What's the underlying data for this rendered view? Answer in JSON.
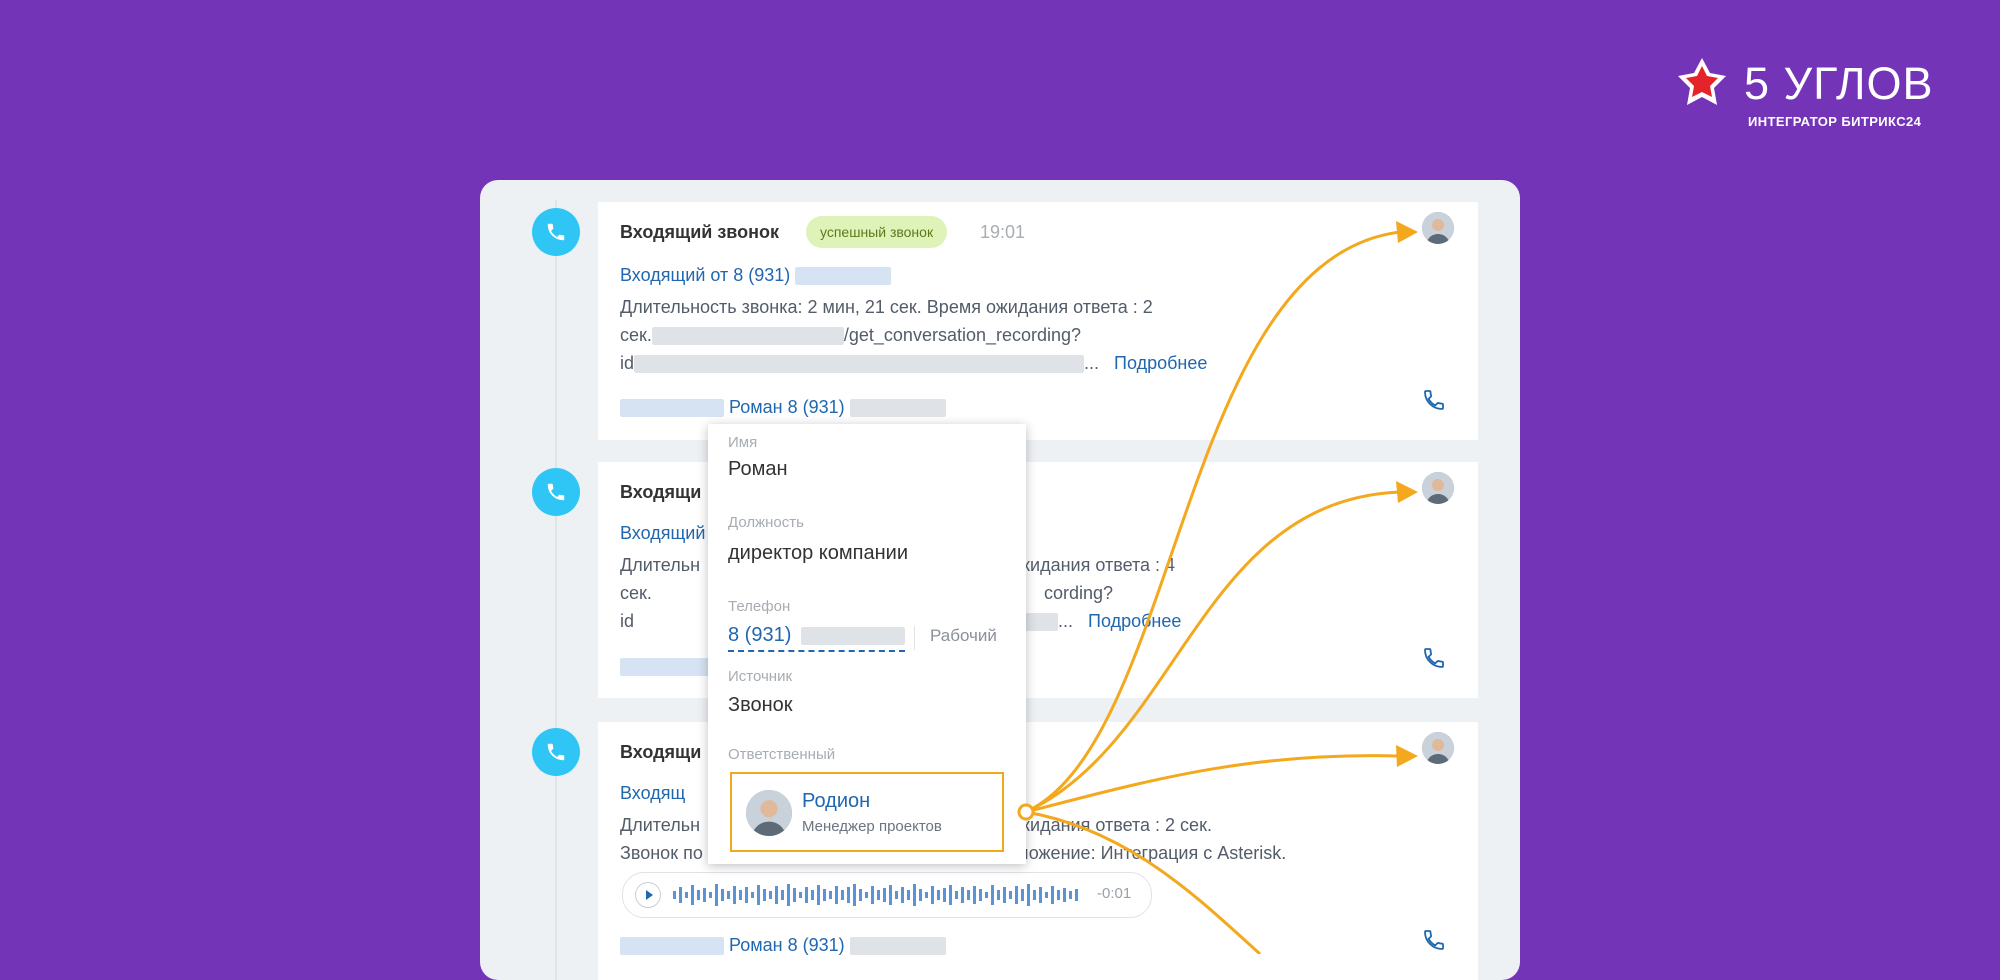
{
  "logo": {
    "title": "5 УГЛОВ",
    "subtitle": "ИНТЕГРАТОР БИТРИКС24"
  },
  "cards": [
    {
      "title": "Входящий звонок",
      "badge": "успешный звонок",
      "time": "19:01",
      "incoming": "Входящий от 8 (931)",
      "duration": "Длительность звонка: 2 мин, 21 сек. Время ожидания ответа : 2",
      "url_prefix": "сек.",
      "url_path": "/get_conversation_recording?",
      "id_prefix": "id",
      "ellipsis": "...",
      "more": "Подробнее",
      "contact": "Роман 8 (931)"
    },
    {
      "title": "Входящи",
      "incoming": "Входящий",
      "duration_start": "Длительн",
      "duration_end": "жидания ответа : 4",
      "url_prefix": "сек.",
      "url_path": "cording?",
      "id_prefix": "id",
      "ellipsis": "...",
      "more": "Подробнее"
    },
    {
      "title": "Входящи",
      "incoming": "Входящ",
      "duration_start": "Длительн",
      "duration_end": "жидания ответа : 2 сек.",
      "note_start": "Звонок по",
      "note_end": "ложение: Интеграция с Asterisk.",
      "player_time": "-0:01",
      "contact": "Роман 8 (931)"
    }
  ],
  "popup": {
    "name_label": "Имя",
    "name": "Роман",
    "position_label": "Должность",
    "position": "директор компании",
    "phone_label": "Телефон",
    "phone": "8 (931)",
    "phone_type": "Рабочий",
    "source_label": "Источник",
    "source": "Звонок",
    "responsible_label": "Ответственный",
    "responsible_name": "Родион",
    "responsible_role": "Менеджер проектов"
  },
  "colors": {
    "background": "#7434b8",
    "accent": "#f3a81d",
    "link": "#2067b0",
    "timeline_icon": "#2fc6f6",
    "badge_bg": "#dff3b8"
  }
}
